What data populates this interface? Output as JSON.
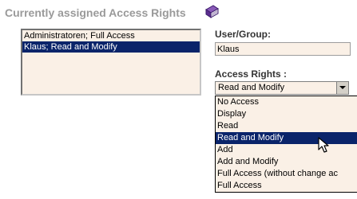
{
  "section": {
    "title": "Currently assigned Access Rights",
    "icon": "book-icon"
  },
  "assigned_list": {
    "items": [
      {
        "label": "Administratoren; Full Access",
        "selected": false
      },
      {
        "label": "Klaus; Read and Modify",
        "selected": true
      }
    ]
  },
  "user_group": {
    "label": "User/Group:",
    "value": "Klaus"
  },
  "access_rights": {
    "label": "Access Rights :",
    "selected_value": "Read and Modify",
    "options": [
      {
        "label": "No Access",
        "selected": false
      },
      {
        "label": "Display",
        "selected": false
      },
      {
        "label": "Read",
        "selected": false
      },
      {
        "label": "Read and Modify",
        "selected": true
      },
      {
        "label": "Add",
        "selected": false
      },
      {
        "label": "Add and Modify",
        "selected": false
      },
      {
        "label": "Full Access (without change ac",
        "selected": false
      },
      {
        "label": "Full Access",
        "selected": false
      }
    ]
  },
  "colors": {
    "field_background": "#faf0e6",
    "selection": "#0a246a",
    "header_text": "#9a9a9a"
  }
}
